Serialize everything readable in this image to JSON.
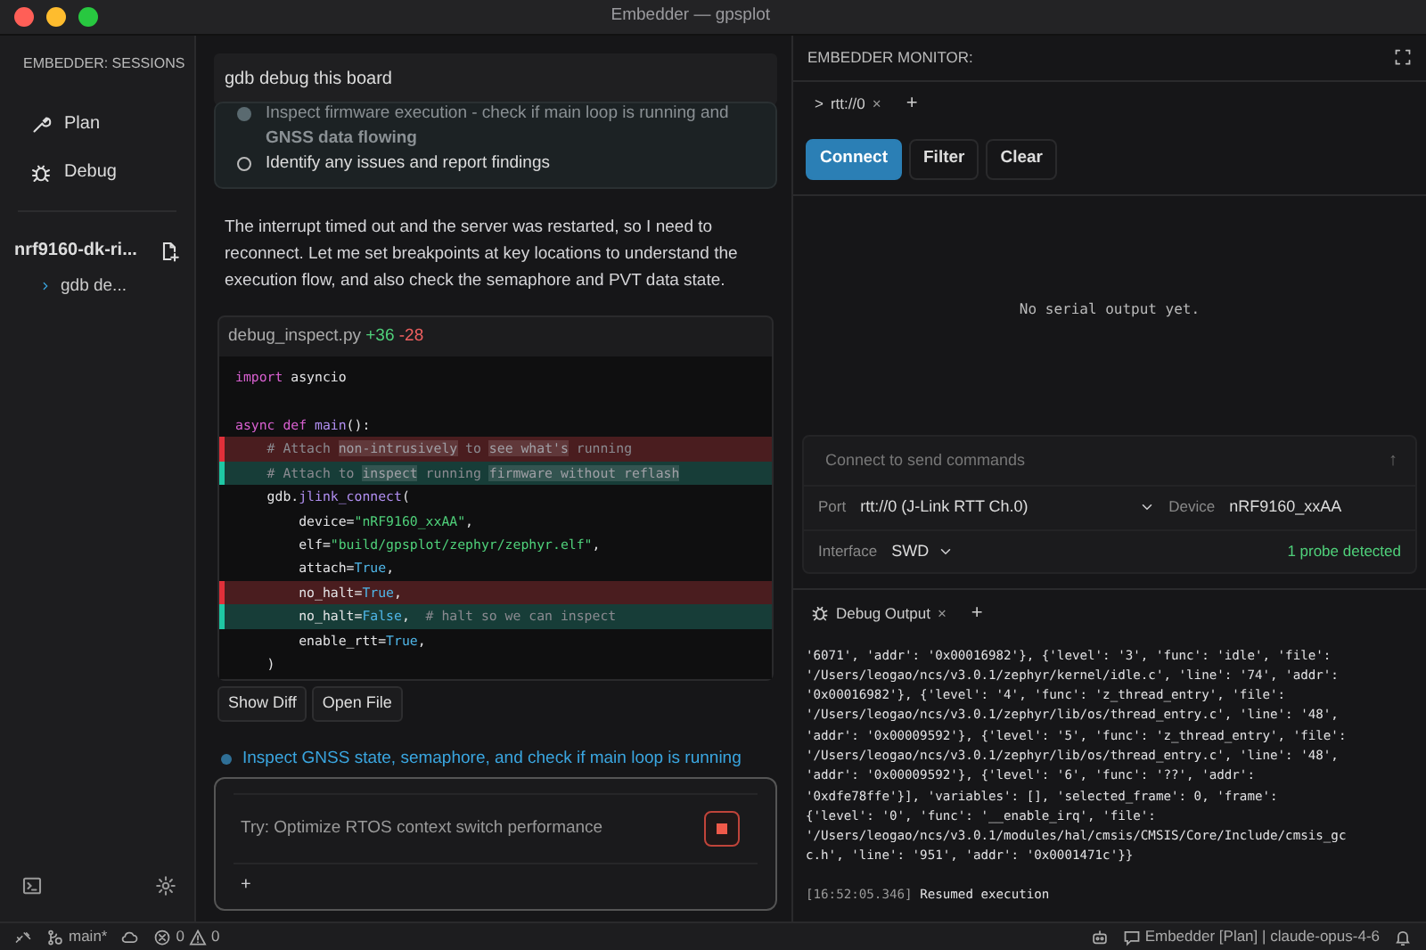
{
  "window": {
    "title": "Embedder — gpsplot"
  },
  "sidebar": {
    "title": "EMBEDDER: SESSIONS",
    "modes": [
      {
        "label": "Plan"
      },
      {
        "label": "Debug"
      }
    ],
    "project": {
      "name": "nrf9160-dk-ri...",
      "sessions": [
        {
          "label": "gdb de..."
        }
      ]
    }
  },
  "chat": {
    "header": "gdb debug this board",
    "tasks": [
      {
        "text": "Inspect firmware execution - check if main loop is running and **GNSS data flowing**",
        "kind": "current"
      },
      {
        "text": "Identify any issues and report findings",
        "kind": "pending"
      }
    ],
    "message": "The interrupt timed out and the server was restarted, so I need to reconnect. Let me set breakpoints at key locations to understand the execution flow, and also check the semaphore and PVT data state.",
    "diff": {
      "file": "debug_inspect.py",
      "added": "+36",
      "removed": "-28",
      "lines": [
        {
          "kind": "none",
          "tokens": [
            {
              "kind": "kw",
              "t": "import"
            },
            {
              "kind": "plain",
              "t": " asyncio"
            }
          ]
        },
        {
          "kind": "none"
        },
        {
          "kind": "none",
          "tokens": [
            {
              "kind": "kw",
              "t": "async def"
            },
            {
              "kind": "fn",
              "t": " main"
            },
            {
              "kind": "plain",
              "t": "():"
            }
          ]
        },
        {
          "kind": "del",
          "tokens": [
            {
              "kind": "cm",
              "t": "    # Attach "
            },
            {
              "kind": "hl",
              "t": "non-intrusively"
            },
            {
              "kind": "cm",
              "t": " to "
            },
            {
              "kind": "hl",
              "t": "see what's"
            },
            {
              "kind": "cm",
              "t": " running"
            }
          ]
        },
        {
          "kind": "add",
          "tokens": [
            {
              "kind": "cm",
              "t": "    # Attach to "
            },
            {
              "kind": "hl",
              "t": "inspect"
            },
            {
              "kind": "cm",
              "t": " running "
            },
            {
              "kind": "hl",
              "t": "firmware without reflash"
            }
          ]
        },
        {
          "kind": "none",
          "tokens": [
            {
              "kind": "plain",
              "t": "    gdb."
            },
            {
              "kind": "fn",
              "t": "jlink_connect"
            },
            {
              "kind": "plain",
              "t": "("
            }
          ]
        },
        {
          "kind": "none",
          "tokens": [
            {
              "kind": "plain",
              "t": "        device="
            },
            {
              "kind": "str",
              "t": "\"nRF9160_xxAA\""
            },
            {
              "kind": "plain",
              "t": ","
            }
          ]
        },
        {
          "kind": "none",
          "tokens": [
            {
              "kind": "plain",
              "t": "        elf="
            },
            {
              "kind": "str",
              "t": "\"build/gpsplot/zephyr/zephyr.elf\""
            },
            {
              "kind": "plain",
              "t": ","
            }
          ]
        },
        {
          "kind": "none",
          "tokens": [
            {
              "kind": "plain",
              "t": "        attach="
            },
            {
              "kind": "bool",
              "t": "True"
            },
            {
              "kind": "plain",
              "t": ","
            }
          ]
        },
        {
          "kind": "del",
          "tokens": [
            {
              "kind": "plain",
              "t": "        no_halt="
            },
            {
              "kind": "bool",
              "t": "True"
            },
            {
              "kind": "plain",
              "t": ","
            }
          ]
        },
        {
          "kind": "add",
          "tokens": [
            {
              "kind": "plain",
              "t": "        no_halt="
            },
            {
              "kind": "bool",
              "t": "False"
            },
            {
              "kind": "plain",
              "t": ","
            },
            {
              "kind": "cm",
              "t": "  # halt so we can inspect"
            }
          ]
        },
        {
          "kind": "none",
          "tokens": [
            {
              "kind": "plain",
              "t": "        enable_rtt="
            },
            {
              "kind": "bool",
              "t": "True"
            },
            {
              "kind": "plain",
              "t": ","
            }
          ]
        },
        {
          "kind": "none",
          "tokens": [
            {
              "kind": "plain",
              "t": "    )"
            }
          ]
        }
      ],
      "buttons": [
        "Show Diff",
        "Open File"
      ]
    },
    "status_line": "Inspect GNSS state, semaphore, and check if main loop is running",
    "input": {
      "placeholder": "Try: Optimize RTOS context switch performance",
      "add": "+"
    }
  },
  "monitor": {
    "title": "EMBEDDER MONITOR:",
    "tabs": [
      {
        "prompt": ">",
        "label": "rtt://0",
        "close": "×"
      }
    ],
    "new_tab": "+",
    "buttons": [
      {
        "label": "Connect",
        "kind": "primary"
      },
      {
        "label": "Filter",
        "kind": "plain"
      },
      {
        "label": "Clear",
        "kind": "plain"
      }
    ],
    "empty": "No serial output yet.",
    "command": {
      "placeholder": "Connect to send commands",
      "send": "↑"
    },
    "port": {
      "label": "Port",
      "value": "rtt://0 (J-Link RTT Ch.0)"
    },
    "device": {
      "label": "Device",
      "value": "nRF9160_xxAA"
    },
    "interface": {
      "label": "Interface",
      "value": "SWD"
    },
    "probes": "1 probe detected"
  },
  "output": {
    "tabs": [
      {
        "label": "Debug Output",
        "close": "×"
      }
    ],
    "new_tab": "+",
    "lines": [
      "'6071', 'addr': '0x00016982'}, {'level': '3', 'func': 'idle', 'file':",
      "'/Users/leogao/ncs/v3.0.1/zephyr/kernel/idle.c', 'line': '74', 'addr':",
      "'0x00016982'}, {'level': '4', 'func': 'z_thread_entry', 'file':",
      "'/Users/leogao/ncs/v3.0.1/zephyr/lib/os/thread_entry.c', 'line': '48',",
      "'addr': '0x00009592'}, {'level': '5', 'func': 'z_thread_entry', 'file':",
      "'/Users/leogao/ncs/v3.0.1/zephyr/lib/os/thread_entry.c', 'line': '48',",
      "'addr': '0x00009592'}, {'level': '6', 'func': '??', 'addr':",
      "'0xdfe78ffe'}], 'variables': [], 'selected_frame': 0, 'frame':",
      "{'level': '0', 'func': '__enable_irq', 'file':",
      "'/Users/leogao/ncs/v3.0.1/modules/hal/cmsis/CMSIS/Core/Include/cmsis_gc",
      "c.h', 'line': '951', 'addr': '0x0001471c'}}"
    ],
    "event": {
      "time": "[16:52:05.346]",
      "text": "Resumed execution"
    }
  },
  "status_bar": {
    "branch": "main*",
    "errors": "0",
    "warnings": "0",
    "agent": "Embedder [Plan] | claude-opus-4-6"
  }
}
